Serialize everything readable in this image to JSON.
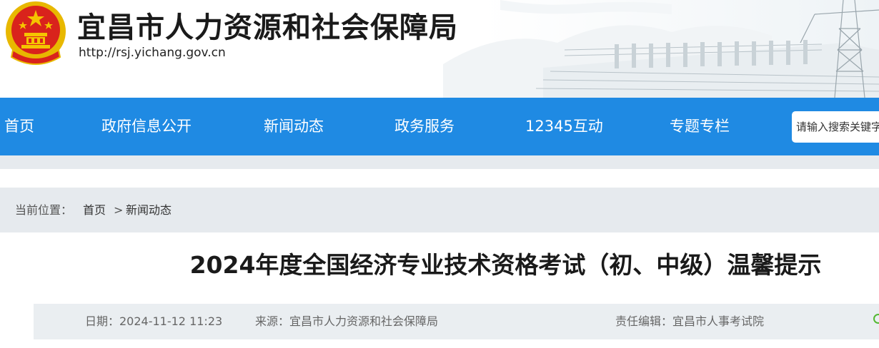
{
  "header": {
    "title": "宜昌市人力资源和社会保障局",
    "url": "http://rsj.yichang.gov.cn"
  },
  "nav": {
    "items": [
      {
        "label": "首页"
      },
      {
        "label": "政府信息公开"
      },
      {
        "label": "新闻动态"
      },
      {
        "label": "政务服务"
      },
      {
        "label": "12345互动"
      },
      {
        "label": "专题专栏"
      }
    ],
    "search_placeholder": "请输入搜索关键字"
  },
  "breadcrumb": {
    "label": "当前位置：",
    "items": [
      "首页",
      "新闻动态"
    ],
    "separator": ">"
  },
  "article": {
    "title": "2024年度全国经济专业技术资格考试（初、中级）温馨提示",
    "date": "日期：2024-11-12 11:23",
    "source": "来源：宜昌市人力资源和社会保障局",
    "editor": "责任编辑：宜昌市人事考试院"
  },
  "colors": {
    "nav_bg": "#1f8ae3",
    "crumb_bg": "#e6eaee",
    "emblem_red": "#d9231c",
    "emblem_gold": "#f5c400"
  }
}
